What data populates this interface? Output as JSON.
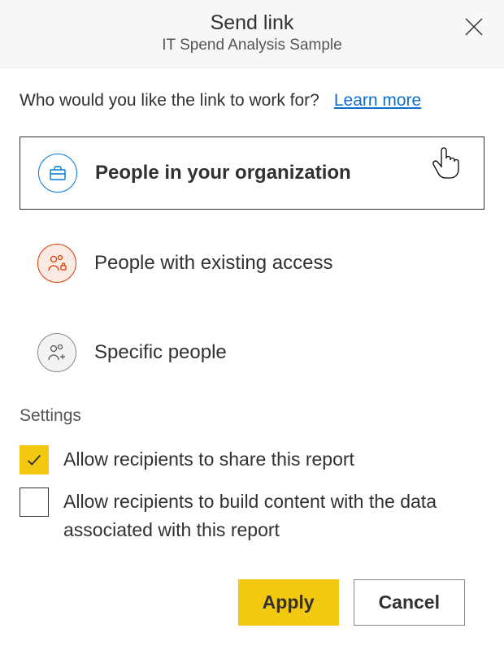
{
  "header": {
    "title": "Send link",
    "subtitle": "IT Spend Analysis Sample"
  },
  "prompt": {
    "text": "Who would you like the link to work for?",
    "learn_more": "Learn more"
  },
  "options": {
    "org": "People in your organization",
    "existing": "People with existing access",
    "specific": "Specific people"
  },
  "settings": {
    "title": "Settings",
    "allow_share": "Allow recipients to share this report",
    "allow_build": "Allow recipients to build content with the data associated with this report"
  },
  "footer": {
    "apply": "Apply",
    "cancel": "Cancel"
  }
}
